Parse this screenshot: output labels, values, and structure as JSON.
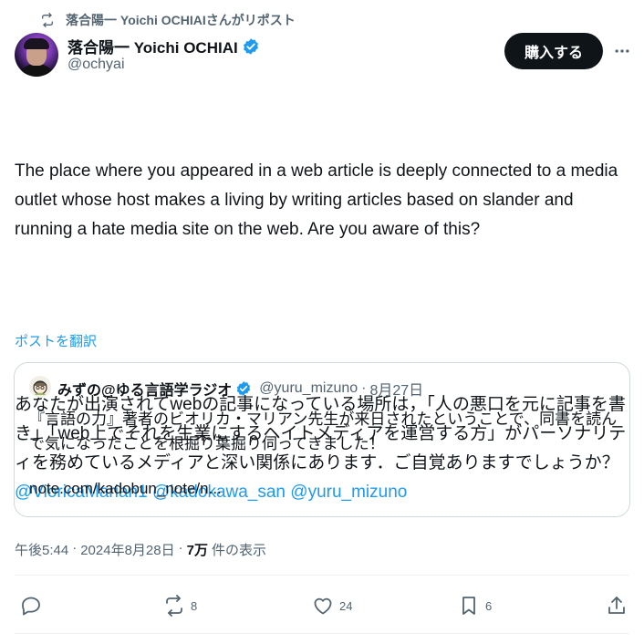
{
  "repost": {
    "text": "落合陽一 Yoichi OCHIAIさんがリポスト",
    "icon": "repost-icon"
  },
  "author": {
    "name": "落合陽一 Yoichi OCHIAI",
    "handle": "@ochyai",
    "verified": true
  },
  "header": {
    "buy_label": "購入する"
  },
  "tweet": {
    "text_en": "The place where you appeared in a web article is deeply connected to a media outlet whose host makes a living by writing articles based on slander and running a hate media site on the web. Are you aware of this?",
    "text_ja_1": "あなたが出演されてwebの記事になっている場所は，「人の悪口を元に記事を書き」「web上でそれを生業にするヘイトメディアを運営する方」がパーソナリティを務めているメディアと深い関係にあります．ご自覚ありますでしょうか？",
    "mention_1": "@VioricaMarian1",
    "mention_2": "@kadokawa_san",
    "mention_3": "@yuru_mizuno",
    "translate_label": "ポストを翻訳"
  },
  "quote": {
    "name": "みずの@ゆる言語学ラジオ",
    "handle": "@yuru_mizuno",
    "date": "8月27日",
    "text": "『言語の力』著者のビオリカ・マリアン先生が来日されたということで、同書を読んで気になったことを根掘り葉掘り伺ってきました！",
    "url": "note.com/kadobun_note/n..."
  },
  "meta": {
    "time": "午後5:44",
    "date": "2024年8月28日",
    "views_count": "7万",
    "views_label": "件の表示"
  },
  "actions": {
    "reply_count": "",
    "repost_count": "8",
    "like_count": "24",
    "bookmark_count": "6"
  },
  "colors": {
    "accent": "#1d9bf0",
    "text": "#0f1419",
    "muted": "#536471",
    "border": "#cfd9de"
  }
}
